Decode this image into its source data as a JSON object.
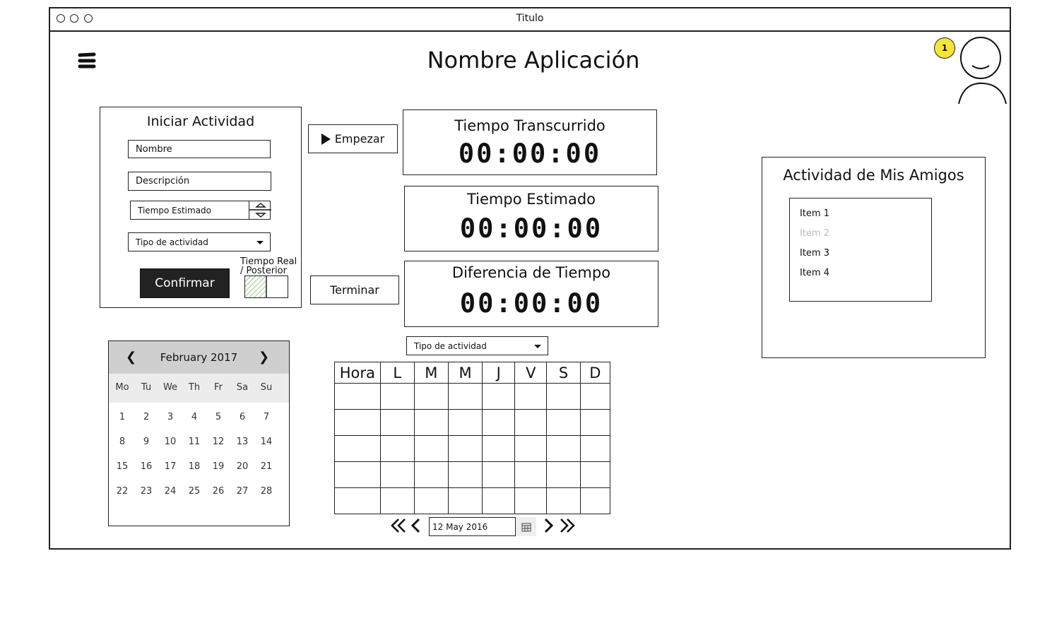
{
  "window": {
    "title": "Titulo"
  },
  "header": {
    "app_name": "Nombre Aplicación",
    "notification_count": "1",
    "accent_color": "#f5e43a"
  },
  "start_form": {
    "title": "Iniciar Actividad",
    "name_placeholder": "Nombre",
    "description_placeholder": "Descripción",
    "estimated_time_placeholder": "Tiempo Estimado",
    "activity_type": "Tipo de actividad",
    "confirm_label": "Confirmar",
    "toggle_label_line1": "Tiempo Real",
    "toggle_label_line2": "/ Posterior"
  },
  "actions": {
    "start_label": "Empezar",
    "stop_label": "Terminar"
  },
  "timers": [
    {
      "title": "Tiempo Transcurrido",
      "value": "00:00:00"
    },
    {
      "title": "Tiempo Estimado",
      "value": "00:00:00"
    },
    {
      "title": "Diferencia de Tiempo",
      "value": "00:00:00"
    }
  ],
  "mini_calendar": {
    "month": "February 2017",
    "weekdays": [
      "Mo",
      "Tu",
      "We",
      "Th",
      "Fr",
      "Sa",
      "Su"
    ],
    "weeks": [
      [
        "1",
        "2",
        "3",
        "4",
        "5",
        "6",
        "7"
      ],
      [
        "8",
        "9",
        "10",
        "11",
        "12",
        "13",
        "14"
      ],
      [
        "15",
        "16",
        "17",
        "18",
        "19",
        "20",
        "21"
      ],
      [
        "22",
        "23",
        "24",
        "25",
        "26",
        "27",
        "28"
      ]
    ]
  },
  "schedule": {
    "filter": "Tipo de actividad",
    "headers": [
      "Hora",
      "L",
      "M",
      "M",
      "J",
      "V",
      "S",
      "D"
    ],
    "date": "12 May 2016"
  },
  "friends": {
    "title": "Actividad de Mis Amigos",
    "items": [
      {
        "label": "Item 1",
        "disabled": false
      },
      {
        "label": "Item 2",
        "disabled": true
      },
      {
        "label": "Item 3",
        "disabled": false
      },
      {
        "label": "Item 4",
        "disabled": false
      }
    ]
  }
}
